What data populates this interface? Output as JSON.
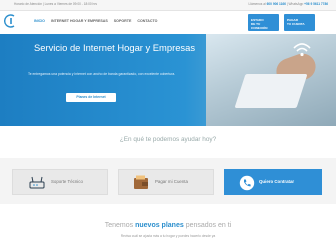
{
  "topbar": {
    "hours": "Horario de Atención | Lunes a Viernes de 09:00 - 18:00 hrs",
    "contact_prefix": "Llámenos al",
    "phone": "600 906 1166",
    "whatsapp_label": "WhatsApp",
    "whatsapp_number": "+56 9 5611 7786"
  },
  "nav": {
    "items": [
      "INICIO",
      "INTERNET HOGAR Y EMPRESAS",
      "SOPORTE",
      "CONTACTO"
    ]
  },
  "header_buttons": {
    "status_line1": "ESTADO",
    "status_line2": "DE TU CONEXIÓN",
    "pay_line1": "PAGAR",
    "pay_line2": "TU CUENTA"
  },
  "hero": {
    "title": "Servicio de Internet Hogar y Empresas",
    "description": "Te entregamos una potencia y Internet con ancho de banda garantizado, con excelente cobertura.",
    "cta_label": "Planes de Internet"
  },
  "question": "¿En qué te podemos ayudar hoy?",
  "cards": [
    {
      "label": "Soporte Técnico",
      "icon": "router-icon"
    },
    {
      "label": "Pagar mi Cuenta",
      "icon": "wallet-icon"
    },
    {
      "label": "Quiero Contratar",
      "icon": "phone-icon"
    }
  ],
  "bottom": {
    "title_prefix": "Tenemos",
    "title_bold": "nuevos planes",
    "title_suffix": "pensados en ti",
    "subtitle": "Revisa cuál se ajusta más a tu hogar y puedes hacerlo desde ya"
  },
  "colors": {
    "primary": "#2f8fd6",
    "hero_start": "#1d7ec2"
  }
}
